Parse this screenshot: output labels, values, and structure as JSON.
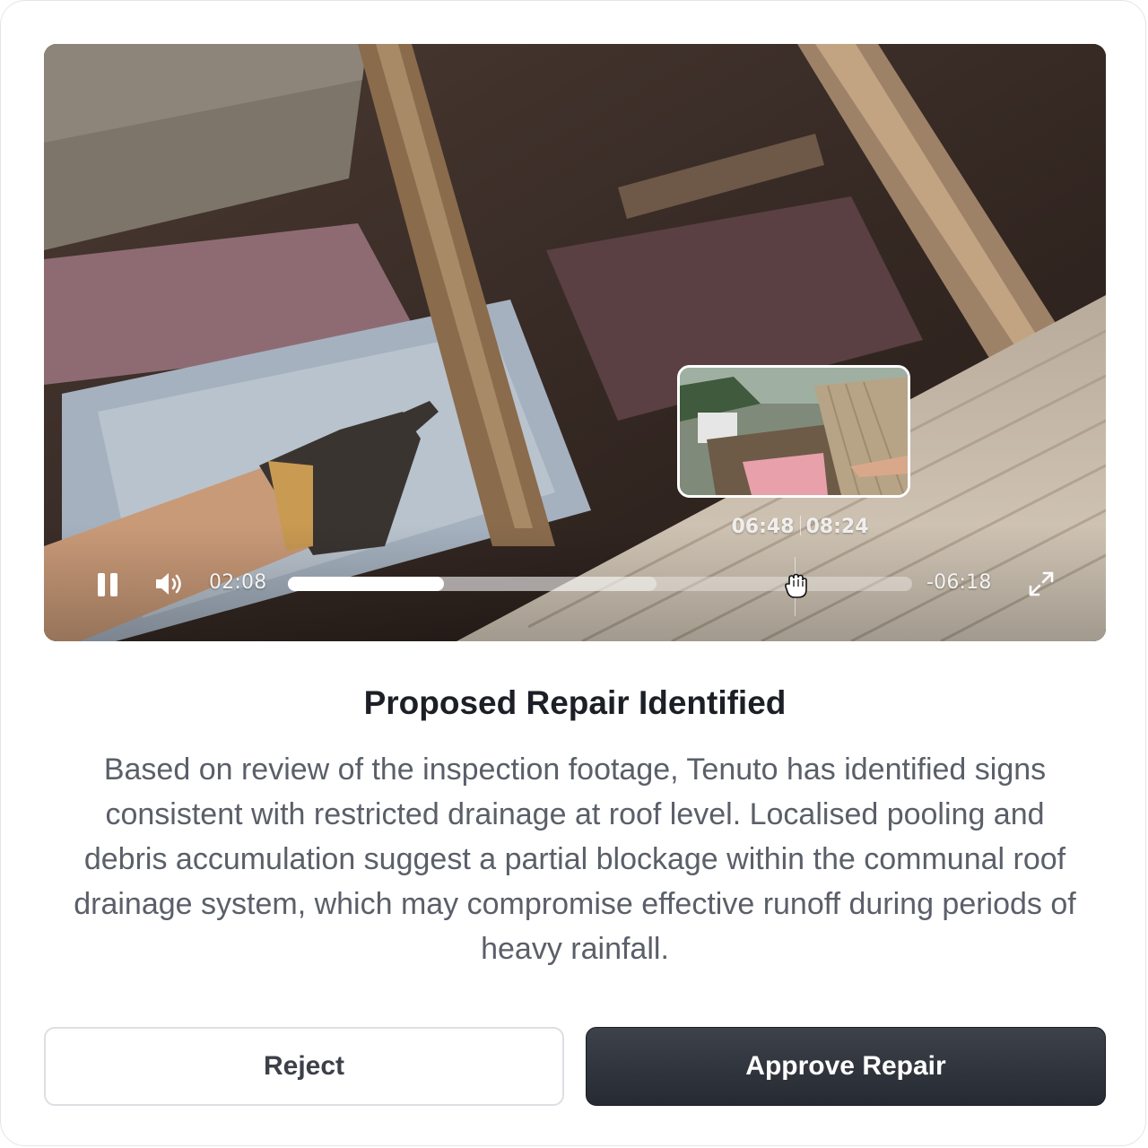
{
  "video": {
    "current_time": "02:08",
    "remaining_time": "-06:18",
    "played_fraction": 0.25,
    "buffered_fraction": 0.59,
    "hover_preview": {
      "time": "06:48",
      "duration": "08:24"
    },
    "icons": {
      "play_pause": "pause-icon",
      "volume": "volume-icon",
      "fullscreen": "fullscreen-icon",
      "cursor": "hand-cursor-icon"
    }
  },
  "result": {
    "heading": "Proposed Repair Identified",
    "description": "Based on review of the inspection footage, Tenuto has identified signs consistent with restricted drainage at roof level. Localised pooling and debris accumulation suggest a partial blockage within the communal roof drainage system, which may compromise effective runoff during periods of heavy rainfall."
  },
  "actions": {
    "reject_label": "Reject",
    "approve_label": "Approve Repair"
  },
  "colors": {
    "approve_bg": "#2b2f36",
    "heading": "#1c1f26",
    "body_text": "#5a5f69",
    "border": "#dcdfe3"
  }
}
